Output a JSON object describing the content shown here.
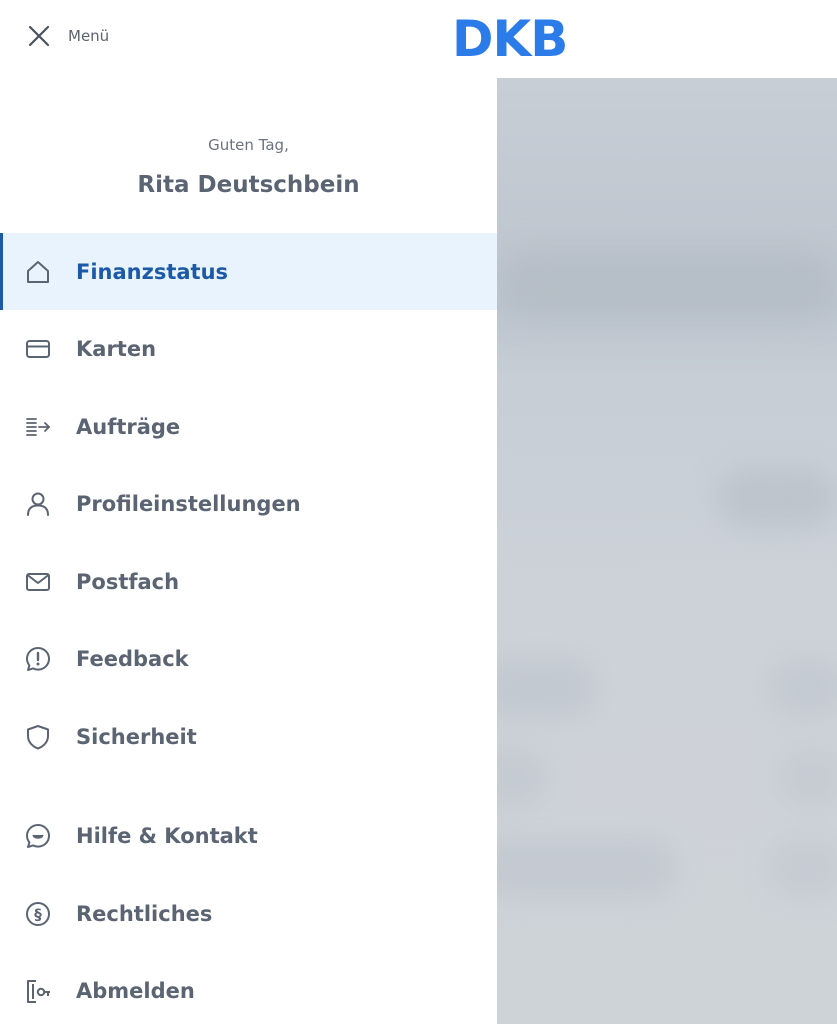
{
  "header": {
    "close_label": "Menü",
    "logo_text": "DKB"
  },
  "drawer": {
    "greeting": "Guten Tag,",
    "username": "Rita Deutschbein",
    "items": [
      {
        "label": "Finanzstatus",
        "icon": "home-icon",
        "active": true
      },
      {
        "label": "Karten",
        "icon": "card-icon",
        "active": false
      },
      {
        "label": "Aufträge",
        "icon": "transfer-icon",
        "active": false
      },
      {
        "label": "Profileinstellungen",
        "icon": "user-icon",
        "active": false
      },
      {
        "label": "Postfach",
        "icon": "mail-icon",
        "active": false
      },
      {
        "label": "Feedback",
        "icon": "feedback-icon",
        "active": false
      },
      {
        "label": "Sicherheit",
        "icon": "shield-icon",
        "active": false
      },
      {
        "label": "Hilfe & Kontakt",
        "icon": "help-chat-icon",
        "active": false
      },
      {
        "label": "Rechtliches",
        "icon": "legal-icon",
        "active": false
      },
      {
        "label": "Abmelden",
        "icon": "logout-icon",
        "active": false
      }
    ]
  },
  "colors": {
    "brand": "#2b7ce9",
    "active_text": "#1c5aa8",
    "active_bg": "#e9f3fd",
    "text": "#5b6472",
    "overlay": "#c8ced6"
  }
}
